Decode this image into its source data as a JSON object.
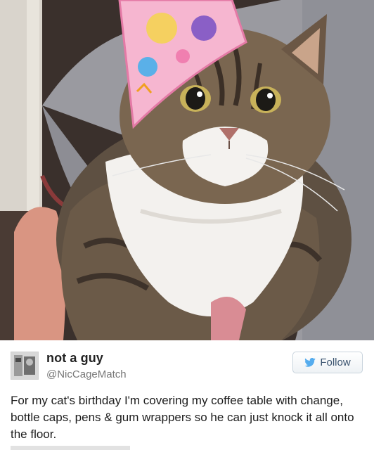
{
  "photo": {
    "subject_icon": "cat-photo",
    "hat_icon": "party-hat"
  },
  "tweet": {
    "display_name": "not a guy",
    "handle": "@NicCageMatch",
    "follow_label": "Follow",
    "text": "For my cat's birthday I'm covering my coffee table with change, bottle caps, pens & gum wrappers so he can just knock it all onto the floor."
  },
  "colors": {
    "follow_text": "#3b5470",
    "bird": "#55acee",
    "background": "#ffffff"
  }
}
